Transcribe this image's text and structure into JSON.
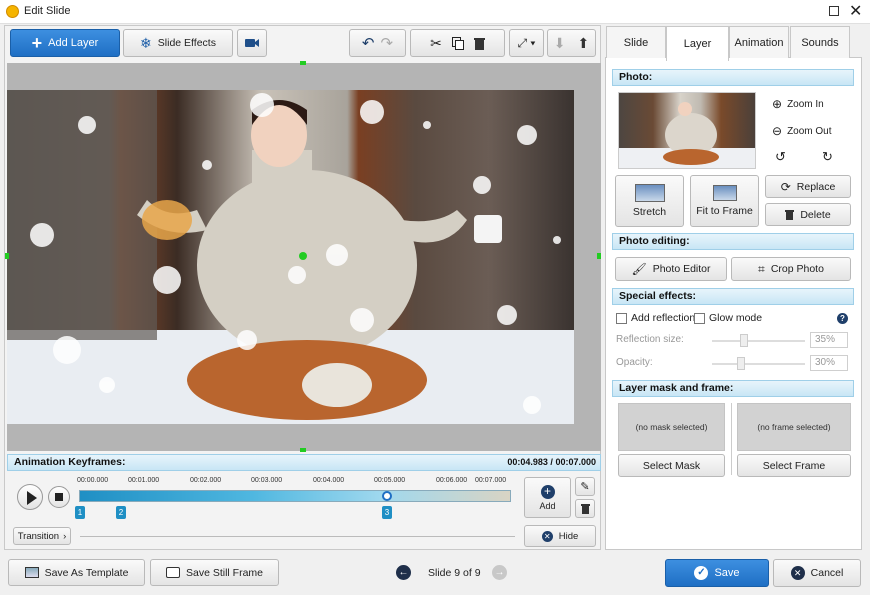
{
  "window": {
    "title": "Edit Slide"
  },
  "toolbar": {
    "add_layer": "Add Layer",
    "slide_effects": "Slide Effects"
  },
  "tabs": [
    {
      "label": "Slide"
    },
    {
      "label": "Layer"
    },
    {
      "label": "Animation"
    },
    {
      "label": "Sounds"
    }
  ],
  "photo": {
    "header": "Photo:",
    "zoom_in": "Zoom In",
    "zoom_out": "Zoom Out",
    "stretch": "Stretch",
    "fit_to_frame": "Fit to Frame",
    "replace": "Replace",
    "delete": "Delete"
  },
  "photo_editing": {
    "header": "Photo editing:",
    "photo_editor": "Photo Editor",
    "crop_photo": "Crop Photo"
  },
  "special_effects": {
    "header": "Special effects:",
    "add_reflection": "Add reflection",
    "glow_mode": "Glow mode",
    "reflection_size_label": "Reflection size:",
    "reflection_size_value": "35%",
    "opacity_label": "Opacity:",
    "opacity_value": "30%"
  },
  "mask_frame": {
    "header": "Layer mask and frame:",
    "no_mask": "(no mask selected)",
    "no_frame": "(no frame selected)",
    "select_mask": "Select Mask",
    "select_frame": "Select Frame"
  },
  "keyframes": {
    "header": "Animation Keyframes:",
    "current_time": "00:04.983",
    "separator": "/",
    "total_time": "00:07.000",
    "ticks": [
      "00:00.000",
      "00:01.000",
      "00:02.000",
      "00:03.000",
      "00:04.000",
      "00:05.000",
      "00:06.000",
      "00:07.000"
    ],
    "markers": [
      "1",
      "2",
      "3"
    ],
    "add": "Add",
    "hide": "Hide",
    "transition": "Transition"
  },
  "footer": {
    "save_as_template": "Save As Template",
    "save_still_frame": "Save Still Frame",
    "slide_indicator": "Slide 9 of 9",
    "save": "Save",
    "cancel": "Cancel"
  },
  "colors": {
    "accent": "#1f6fc4",
    "section_bg": "#c8e6f5",
    "selection_green": "#22cc22",
    "marker": "#1f8fc4"
  },
  "icons": [
    "plus-icon",
    "snowflake-icon",
    "camera-icon",
    "undo-icon",
    "redo-icon",
    "scissors-icon",
    "copy-icon",
    "trash-icon",
    "fullscreen-icon",
    "arrow-down-icon",
    "arrow-up-icon"
  ]
}
